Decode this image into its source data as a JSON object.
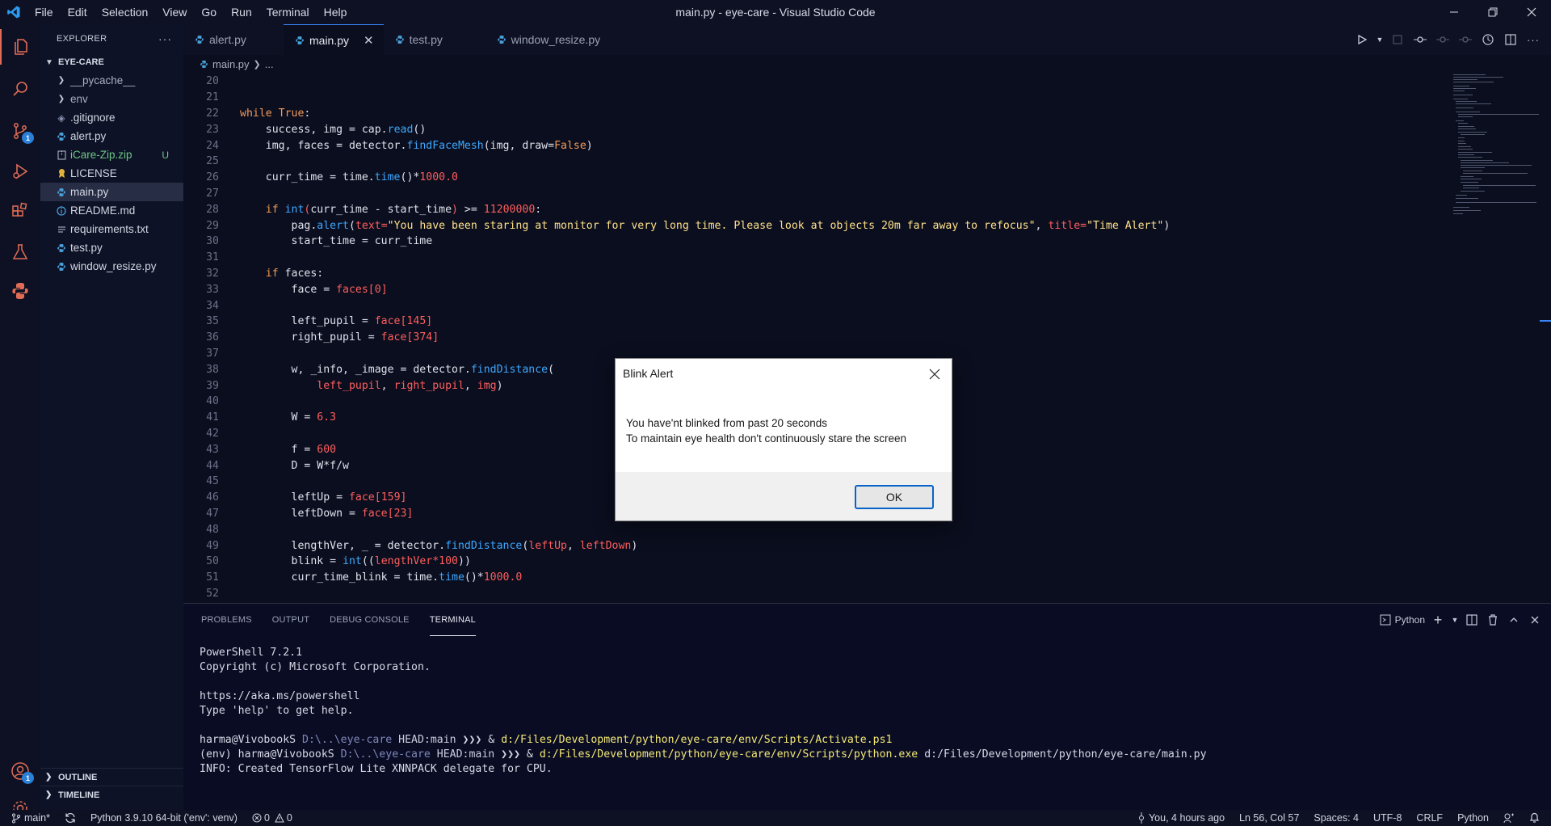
{
  "window": {
    "title": "main.py - eye-care - Visual Studio Code"
  },
  "menu": [
    "File",
    "Edit",
    "Selection",
    "View",
    "Go",
    "Run",
    "Terminal",
    "Help"
  ],
  "activity": {
    "scm_badge": "1",
    "accounts_badge": "1"
  },
  "sidebar": {
    "header": "EXPLORER",
    "more": "···",
    "folder": "EYE-CARE",
    "items": [
      {
        "label": "__pycache__",
        "type": "folder"
      },
      {
        "label": "env",
        "type": "folder"
      },
      {
        "label": ".gitignore",
        "type": "file"
      },
      {
        "label": "alert.py",
        "type": "python"
      },
      {
        "label": "iCare-Zip.zip",
        "type": "zip",
        "status": "U"
      },
      {
        "label": "LICENSE",
        "type": "license"
      },
      {
        "label": "main.py",
        "type": "python"
      },
      {
        "label": "README.md",
        "type": "info"
      },
      {
        "label": "requirements.txt",
        "type": "text"
      },
      {
        "label": "test.py",
        "type": "python"
      },
      {
        "label": "window_resize.py",
        "type": "python"
      }
    ],
    "outline": "OUTLINE",
    "timeline": "TIMELINE"
  },
  "tabs": [
    "alert.py",
    "main.py",
    "test.py",
    "window_resize.py"
  ],
  "breadcrumb": {
    "file": "main.py",
    "rest": "..."
  },
  "editor": {
    "lines": [
      {
        "n": "20",
        "c": []
      },
      {
        "n": "21",
        "c": []
      },
      {
        "n": "22",
        "c": [
          [
            "kw",
            "while "
          ],
          [
            "kw",
            "True"
          ],
          [
            "pu",
            ":"
          ]
        ]
      },
      {
        "n": "23",
        "c": [
          [
            "pu",
            "    success, img = cap."
          ],
          [
            "fn",
            "read"
          ],
          [
            "pu",
            "()"
          ]
        ]
      },
      {
        "n": "24",
        "c": [
          [
            "pu",
            "    img, faces = detector."
          ],
          [
            "fn",
            "findFaceMesh"
          ],
          [
            "pu",
            "(img, draw="
          ],
          [
            "kw",
            "False"
          ],
          [
            "pu",
            ")"
          ]
        ]
      },
      {
        "n": "25",
        "c": []
      },
      {
        "n": "26",
        "c": [
          [
            "pu",
            "    curr_time = time."
          ],
          [
            "fn",
            "time"
          ],
          [
            "pu",
            "()*"
          ],
          [
            "num",
            "1000.0"
          ]
        ]
      },
      {
        "n": "27",
        "c": []
      },
      {
        "n": "28",
        "c": [
          [
            "kw",
            "    if "
          ],
          [
            "fn",
            "int"
          ],
          [
            "par",
            "("
          ],
          [
            "pu",
            "curr_time - start_time"
          ],
          [
            "par",
            ")"
          ],
          [
            "pu",
            " >= "
          ],
          [
            "num",
            "11200000"
          ],
          [
            "pu",
            ":"
          ]
        ]
      },
      {
        "n": "29",
        "c": [
          [
            "pu",
            "        pag."
          ],
          [
            "fn",
            "alert"
          ],
          [
            "pu",
            "("
          ],
          [
            "par",
            "text="
          ],
          [
            "str",
            "\"You have been staring at monitor for very long time. Please look at objects 20m far away to refocus\""
          ],
          [
            "pu",
            ", "
          ],
          [
            "par",
            "title="
          ],
          [
            "str",
            "\"Time Alert\""
          ],
          [
            "pu",
            ")"
          ]
        ]
      },
      {
        "n": "30",
        "c": [
          [
            "pu",
            "        start_time = curr_time"
          ]
        ]
      },
      {
        "n": "31",
        "c": []
      },
      {
        "n": "32",
        "c": [
          [
            "kw",
            "    if "
          ],
          [
            "pu",
            "faces:"
          ]
        ]
      },
      {
        "n": "33",
        "c": [
          [
            "pu",
            "        face = "
          ],
          [
            "par",
            "faces["
          ],
          [
            "num",
            "0"
          ],
          [
            "par",
            "]"
          ]
        ]
      },
      {
        "n": "34",
        "c": []
      },
      {
        "n": "35",
        "c": [
          [
            "pu",
            "        left_pupil = "
          ],
          [
            "par",
            "face["
          ],
          [
            "num",
            "145"
          ],
          [
            "par",
            "]"
          ]
        ]
      },
      {
        "n": "36",
        "c": [
          [
            "pu",
            "        right_pupil = "
          ],
          [
            "par",
            "face["
          ],
          [
            "num",
            "374"
          ],
          [
            "par",
            "]"
          ]
        ]
      },
      {
        "n": "37",
        "c": []
      },
      {
        "n": "38",
        "c": [
          [
            "pu",
            "        w, _info, _image = detector."
          ],
          [
            "fn",
            "findDistance"
          ],
          [
            "pu",
            "("
          ]
        ]
      },
      {
        "n": "39",
        "c": [
          [
            "par",
            "            left_pupil"
          ],
          [
            "pu",
            ", "
          ],
          [
            "par",
            "right_pupil"
          ],
          [
            "pu",
            ", "
          ],
          [
            "par",
            "img"
          ],
          [
            "pu",
            ")"
          ]
        ]
      },
      {
        "n": "40",
        "c": []
      },
      {
        "n": "41",
        "c": [
          [
            "pu",
            "        W = "
          ],
          [
            "num",
            "6.3"
          ]
        ]
      },
      {
        "n": "42",
        "c": []
      },
      {
        "n": "43",
        "c": [
          [
            "pu",
            "        f = "
          ],
          [
            "num",
            "600"
          ]
        ]
      },
      {
        "n": "44",
        "c": [
          [
            "pu",
            "        D = W*f/w"
          ]
        ]
      },
      {
        "n": "45",
        "c": []
      },
      {
        "n": "46",
        "c": [
          [
            "pu",
            "        leftUp = "
          ],
          [
            "par",
            "face["
          ],
          [
            "num",
            "159"
          ],
          [
            "par",
            "]"
          ]
        ]
      },
      {
        "n": "47",
        "c": [
          [
            "pu",
            "        leftDown = "
          ],
          [
            "par",
            "face["
          ],
          [
            "num",
            "23"
          ],
          [
            "par",
            "]"
          ]
        ]
      },
      {
        "n": "48",
        "c": []
      },
      {
        "n": "49",
        "c": [
          [
            "pu",
            "        lengthVer, _ = detector."
          ],
          [
            "fn",
            "findDistance"
          ],
          [
            "pu",
            "("
          ],
          [
            "par",
            "leftUp"
          ],
          [
            "pu",
            ", "
          ],
          [
            "par",
            "leftDown"
          ],
          [
            "pu",
            ")"
          ]
        ]
      },
      {
        "n": "50",
        "c": [
          [
            "pu",
            "        blink = "
          ],
          [
            "fn",
            "int"
          ],
          [
            "pu",
            "(("
          ],
          [
            "par",
            "lengthVer*"
          ],
          [
            "num",
            "100"
          ],
          [
            "pu",
            "))"
          ]
        ]
      },
      {
        "n": "51",
        "c": [
          [
            "pu",
            "        curr_time_blink = time."
          ],
          [
            "fn",
            "time"
          ],
          [
            "pu",
            "()*"
          ],
          [
            "num",
            "1000.0"
          ]
        ]
      },
      {
        "n": "52",
        "c": []
      }
    ]
  },
  "panel": {
    "tabs": [
      "PROBLEMS",
      "OUTPUT",
      "DEBUG CONSOLE",
      "TERMINAL"
    ],
    "active_tab": "TERMINAL",
    "shell": "Python",
    "terminal": [
      [
        [
          "",
          "PowerShell 7.2.1"
        ]
      ],
      [
        [
          "",
          "Copyright (c) Microsoft Corporation."
        ]
      ],
      [
        [
          "",
          ""
        ]
      ],
      [
        [
          "",
          "https://aka.ms/powershell"
        ]
      ],
      [
        [
          "",
          "Type 'help' to get help."
        ]
      ],
      [
        [
          "",
          ""
        ]
      ],
      [
        [
          "",
          "harma@VivobookS "
        ],
        [
          "path",
          "D:\\..\\eye-care "
        ],
        [
          "head",
          "HEAD:main "
        ],
        [
          "",
          "❯❯❯ & "
        ],
        [
          "ylw",
          "d:/Files/Development/python/eye-care/env/Scripts/Activate.ps1"
        ]
      ],
      [
        [
          "",
          "(env) harma@VivobookS "
        ],
        [
          "path",
          "D:\\..\\eye-care "
        ],
        [
          "head",
          "HEAD:main "
        ],
        [
          "",
          "❯❯❯ & "
        ],
        [
          "ylw",
          "d:/Files/Development/python/eye-care/env/Scripts/python.exe"
        ],
        [
          "",
          " d:/Files/Development/python/eye-care/main.py"
        ]
      ],
      [
        [
          "",
          "INFO: Created TensorFlow Lite XNNPACK delegate for CPU."
        ]
      ]
    ]
  },
  "dialog": {
    "title": "Blink Alert",
    "line1": "You have'nt blinked from past 20 seconds",
    "line2": "To maintain eye health don't continuously stare the screen",
    "ok": "OK"
  },
  "status": {
    "branch": "main*",
    "interpreter": "Python 3.9.10 64-bit ('env': venv)",
    "errors": "0",
    "warnings": "0",
    "blame": "You, 4 hours ago",
    "position": "Ln 56, Col 57",
    "spaces": "Spaces: 4",
    "encoding": "UTF-8",
    "eol": "CRLF",
    "language": "Python"
  }
}
